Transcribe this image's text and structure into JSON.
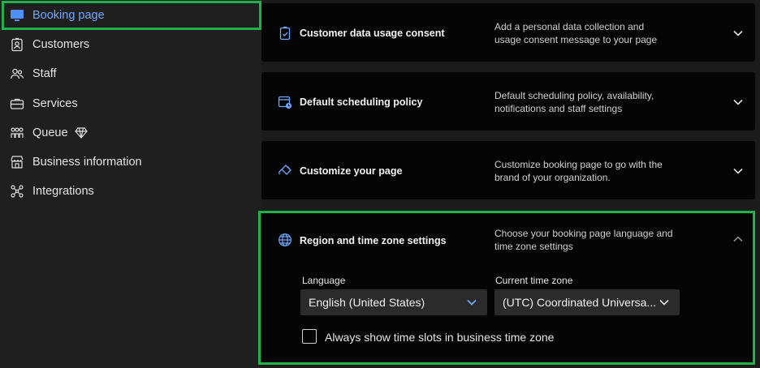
{
  "sidebar": {
    "items": [
      {
        "label": "Booking page",
        "icon": "monitor-icon",
        "active": true
      },
      {
        "label": "Customers",
        "icon": "contact-card-icon"
      },
      {
        "label": "Staff",
        "icon": "people-icon"
      },
      {
        "label": "Services",
        "icon": "briefcase-icon"
      },
      {
        "label": "Queue",
        "icon": "people-queue-icon",
        "badge_icon": "diamond-premium-icon"
      },
      {
        "label": "Business information",
        "icon": "store-icon"
      },
      {
        "label": "Integrations",
        "icon": "integrations-icon"
      }
    ]
  },
  "cards": [
    {
      "title": "Customer data usage consent",
      "description": "Add a personal data collection and usage consent message to your page",
      "icon": "consent-badge-icon",
      "expanded": false
    },
    {
      "title": "Default scheduling policy",
      "description": "Default scheduling policy, availability, notifications and staff settings",
      "icon": "calendar-clock-icon",
      "expanded": false
    },
    {
      "title": "Customize your page",
      "description": "Customize booking page to go with the brand of your organization.",
      "icon": "paint-brush-icon",
      "expanded": false
    },
    {
      "title": "Region and time zone settings",
      "description": "Choose your booking page language and time zone settings",
      "icon": "globe-icon",
      "expanded": true
    }
  ],
  "region": {
    "language_label": "Language",
    "language_value": "English (United States)",
    "timezone_label": "Current time zone",
    "timezone_value": "(UTC) Coordinated Universa...",
    "checkbox_label": "Always show time slots in business time zone",
    "checkbox_checked": false
  },
  "colors": {
    "accent": "#6fa8ff",
    "highlight": "#22b04b",
    "card_bg": "#050505",
    "page_bg": "#1b1b1b"
  }
}
